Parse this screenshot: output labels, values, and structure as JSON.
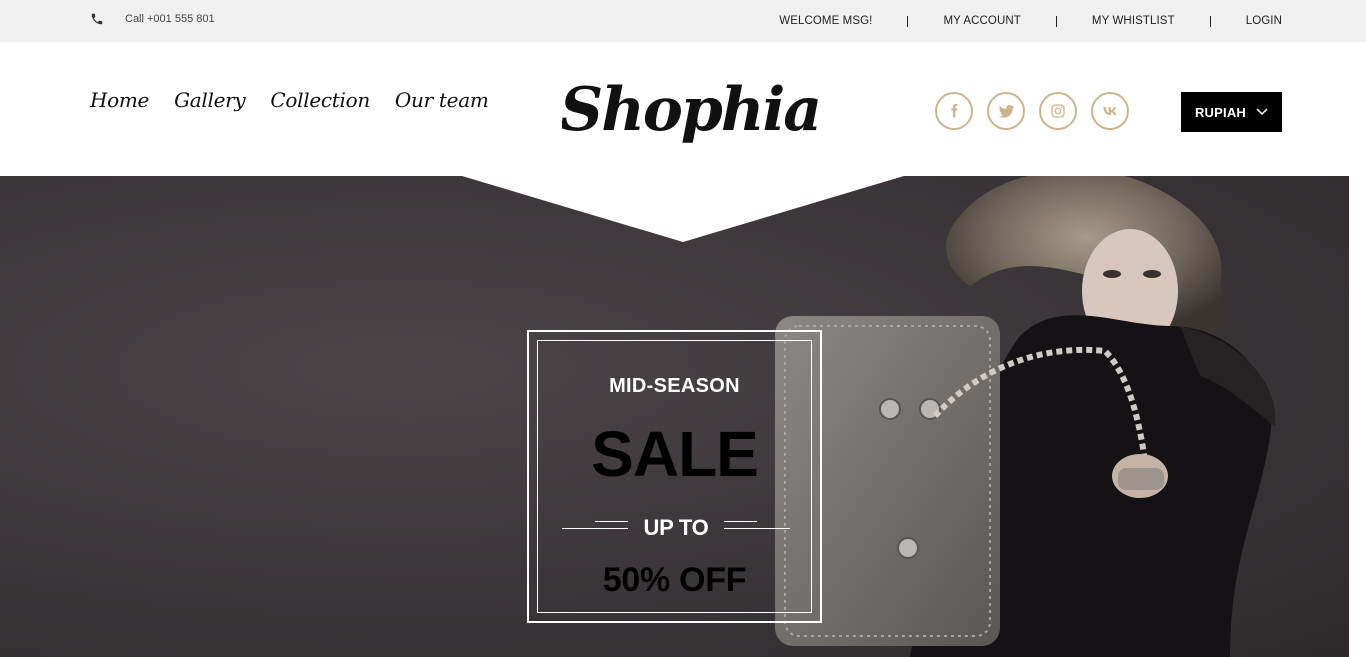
{
  "topbar": {
    "phone_icon": "phone-icon",
    "phone_text": "Call +001 555 801",
    "links": [
      "WELCOME MSG!",
      "MY ACCOUNT",
      "MY WHISTLIST",
      "LOGIN"
    ]
  },
  "header": {
    "nav": [
      "Home",
      "Gallery",
      "Collection",
      "Our team"
    ],
    "logo_text": "Shophia",
    "socials": [
      "facebook-icon",
      "twitter-icon",
      "instagram-icon",
      "vk-icon"
    ],
    "currency": "RUPIAH",
    "accent_color": "#cdb48d"
  },
  "hero": {
    "mid": "MID-SEASON",
    "sale": "SALE",
    "upto": "UP TO",
    "off": "50% OFF"
  }
}
